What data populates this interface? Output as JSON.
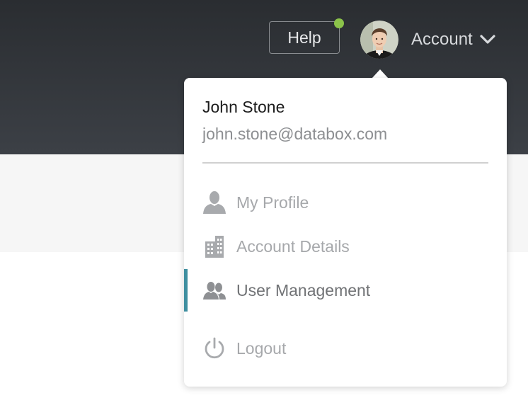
{
  "header": {
    "help_label": "Help",
    "account_label": "Account",
    "avatar_icon": "user-avatar",
    "notification_color": "#8bc34a",
    "chevron_icon": "chevron-down-icon"
  },
  "dropdown": {
    "user_name": "John Stone",
    "user_email": "john.stone@databox.com",
    "items": [
      {
        "label": "My Profile",
        "icon": "person-icon",
        "active": false
      },
      {
        "label": "Account Details",
        "icon": "building-icon",
        "active": false
      },
      {
        "label": "User Management",
        "icon": "users-icon",
        "active": true
      },
      {
        "label": "Logout",
        "icon": "power-icon",
        "active": false
      }
    ],
    "active_accent": "#3f8fa0"
  }
}
